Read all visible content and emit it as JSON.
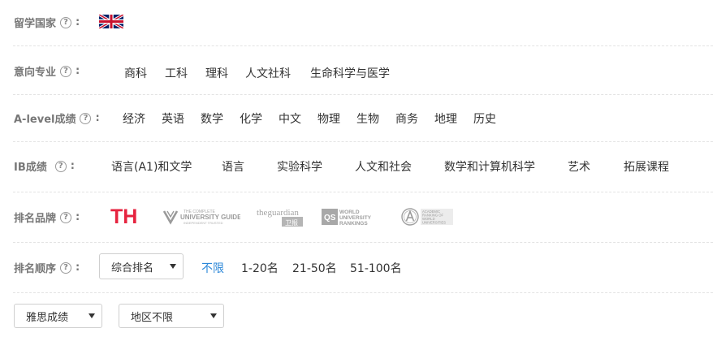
{
  "country": {
    "label": "留学国家",
    "help": "?",
    "flag_icon": "uk-flag-icon"
  },
  "major": {
    "label": "意向专业",
    "help": "?",
    "colon": "：",
    "options": [
      "商科",
      "工科",
      "理科",
      "人文社科",
      "生命科学与医学"
    ]
  },
  "alevel": {
    "label": "A-level成绩",
    "help": "?",
    "colon": "：",
    "options": [
      "经济",
      "英语",
      "数学",
      "化学",
      "中文",
      "物理",
      "生物",
      "商务",
      "地理",
      "历史"
    ]
  },
  "ib": {
    "label": "IB成绩",
    "help": "?",
    "colon": "：",
    "options": [
      "语言(A1)和文学",
      "语言",
      "实验科学",
      "人文和社会",
      "数学和计算机科学",
      "艺术",
      "拓展课程"
    ]
  },
  "brand": {
    "label": "排名品牌",
    "help": "?",
    "colon": "：",
    "logos": {
      "the": "THE",
      "cug_main": "UNIVERSITY GUIDE",
      "cug_top": "THE COMPLETE",
      "cug_sub": "INDEPENDENT TRUSTED",
      "guardian": "theguardian",
      "guardian_sub": "卫报",
      "qs_badge": "QS",
      "qs_lines": [
        "WORLD",
        "UNIVERSITY",
        "RANKINGS"
      ],
      "arwu_lines": [
        "ACADEMIC",
        "RANKING OF",
        "WORLD",
        "UNIVERSITIES"
      ]
    }
  },
  "order": {
    "label": "排名顺序",
    "help": "?",
    "colon": "：",
    "select_value": "综合排名",
    "options": [
      "不限",
      "1-20名",
      "21-50名",
      "51-100名"
    ],
    "active_index": 0
  },
  "filters": {
    "ielts": "雅思成绩",
    "region": "地区不限"
  },
  "colors": {
    "active": "#2b87d8",
    "the_red": "#e6233f",
    "the_blue": "#1b2a6b",
    "label": "#777777"
  }
}
